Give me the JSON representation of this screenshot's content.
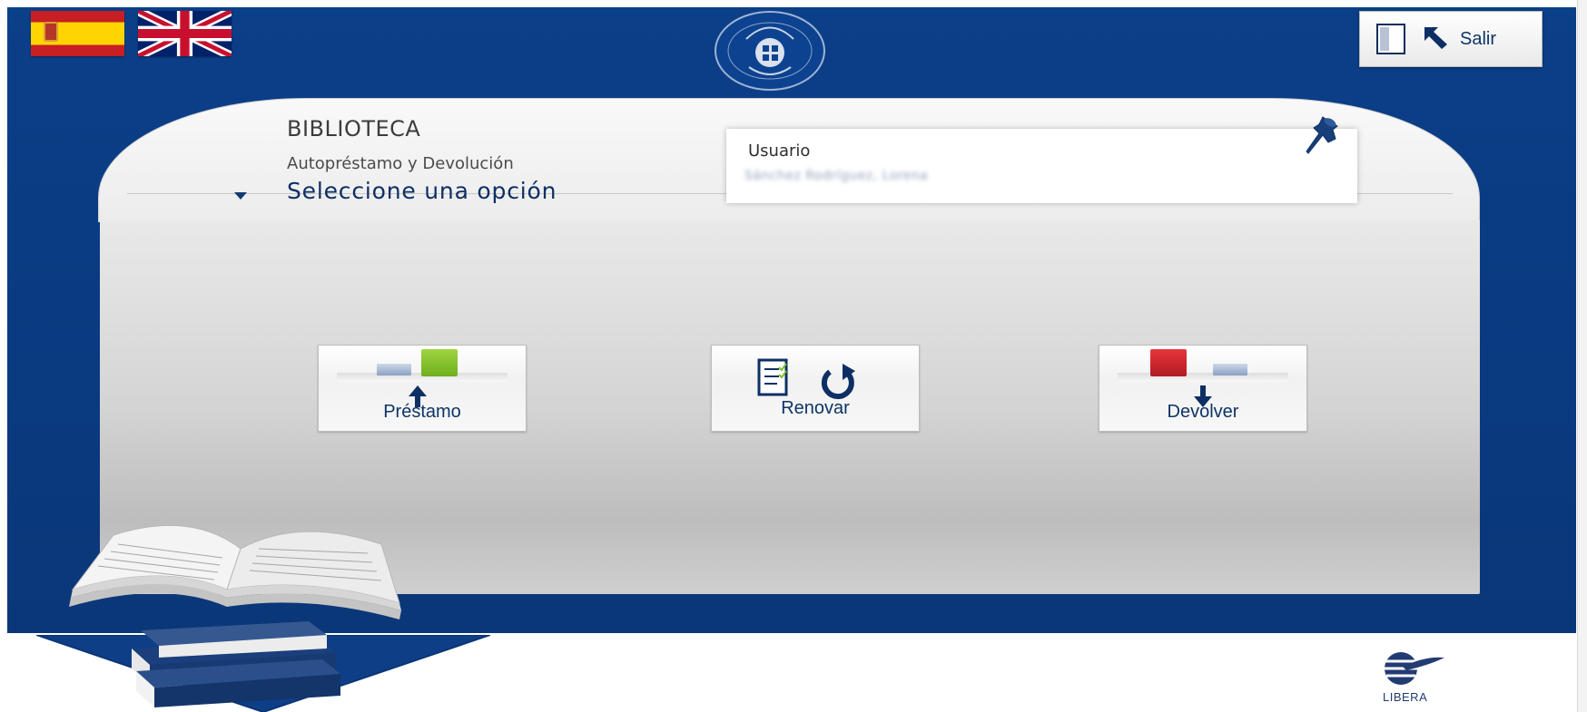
{
  "languages": [
    {
      "code": "es",
      "name": "Español"
    },
    {
      "code": "en",
      "name": "English"
    }
  ],
  "exit": {
    "label": "Salir"
  },
  "header": {
    "title": "BIBLIOTECA",
    "subtitle": "Autopréstamo y Devolución",
    "select_prompt": "Seleccione una opción"
  },
  "user": {
    "label": "Usuario",
    "value": "Sánchez Rodríguez, Lorena"
  },
  "actions": [
    {
      "label": "Préstamo"
    },
    {
      "label": "Renovar"
    },
    {
      "label": "Devolver"
    }
  ],
  "footer": {
    "logo_text": "LIBERA"
  },
  "colors": {
    "navy": "#0b3f88",
    "panel": "#e6e6e6",
    "text_blue": "#0e3466",
    "green_book": "#82c42c",
    "red_book": "#cf2a30"
  }
}
